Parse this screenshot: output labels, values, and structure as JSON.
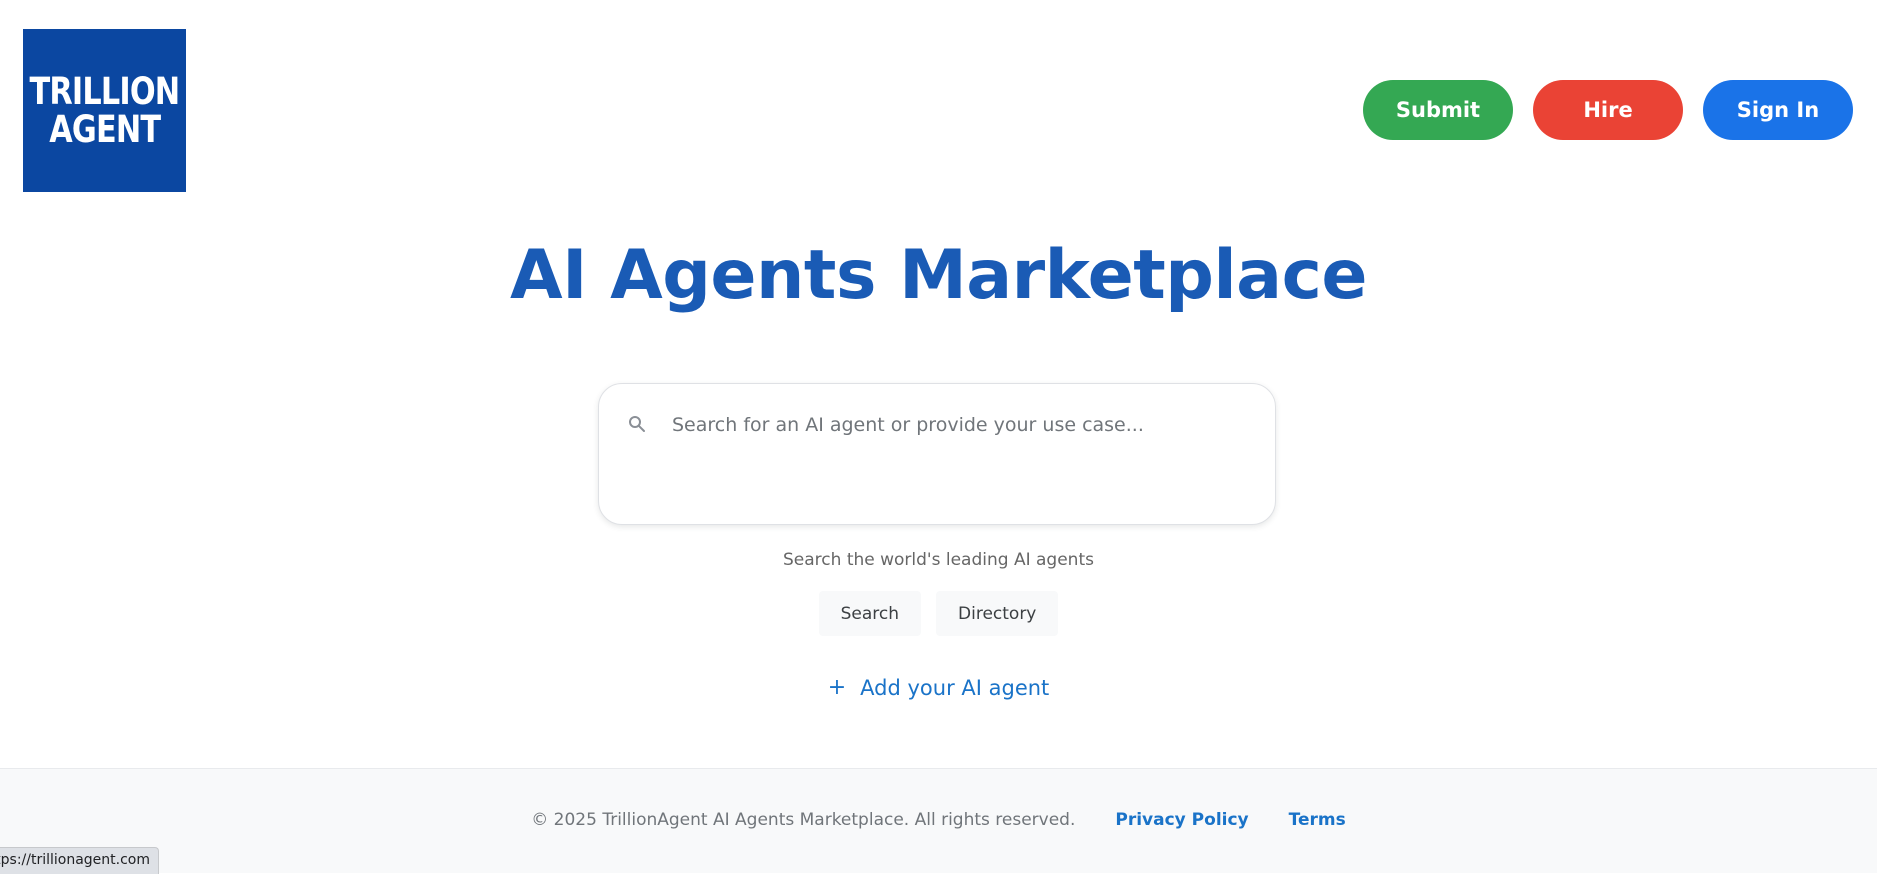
{
  "header": {
    "logo": {
      "line1": "TRILLION",
      "line2": "AGENT",
      "color": "#0b47a1"
    },
    "buttons": {
      "submit": {
        "label": "Submit",
        "color": "#34a853"
      },
      "hire": {
        "label": "Hire",
        "color": "#ea4335"
      },
      "sign_in": {
        "label": "Sign In",
        "color": "#1a73e8"
      }
    }
  },
  "hero": {
    "title": "AI Agents Marketplace",
    "title_color": "#1a5bb5",
    "search": {
      "icon": "search-icon",
      "placeholder": "Search for an AI agent or provide your use case...",
      "value": ""
    },
    "subtitle": "Search the world's leading AI agents",
    "quick_buttons": {
      "search": "Search",
      "directory": "Directory"
    },
    "add_agent": {
      "icon": "+",
      "label": "Add your AI agent"
    }
  },
  "footer": {
    "copyright": "© 2025 TrillionAgent AI Agents Marketplace. All rights reserved.",
    "links": {
      "privacy": "Privacy Policy",
      "terms": "Terms"
    },
    "link_color": "#1a73c8"
  },
  "status_bar": {
    "url": "https://trillionagent.com"
  }
}
